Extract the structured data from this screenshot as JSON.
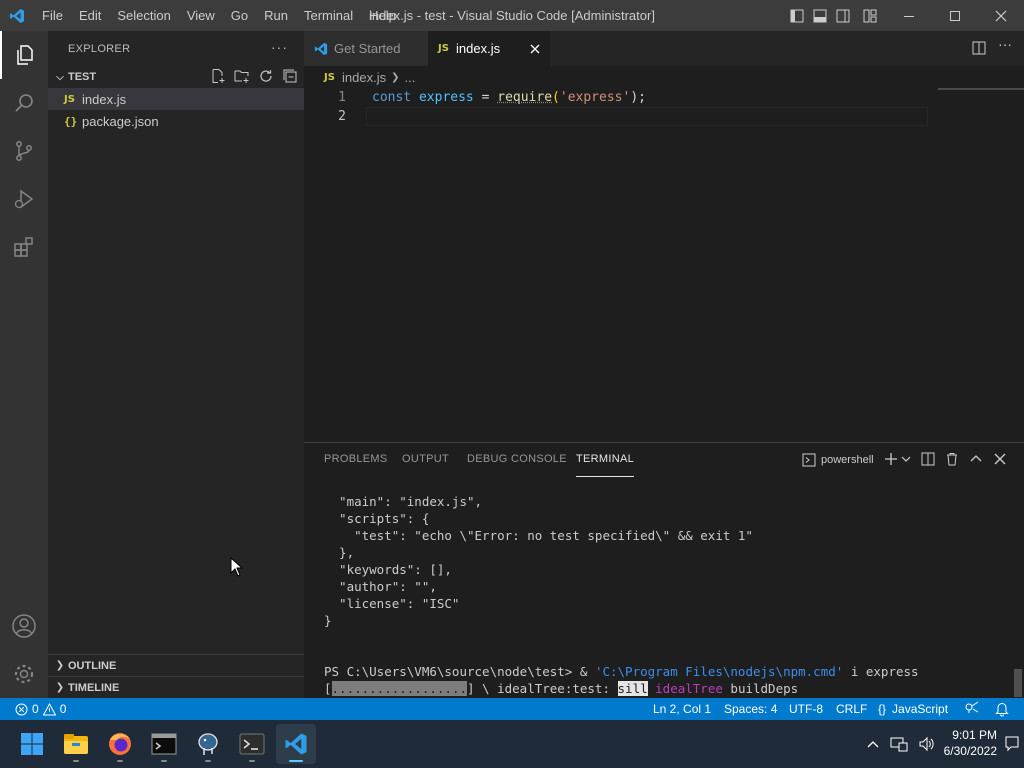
{
  "titlebar": {
    "menu": [
      "File",
      "Edit",
      "Selection",
      "View",
      "Go",
      "Run",
      "Terminal",
      "Help"
    ],
    "title": "index.js - test - Visual Studio Code [Administrator]"
  },
  "sidebar": {
    "header": "EXPLORER",
    "folder": "TEST",
    "files": [
      {
        "name": "index.js",
        "badge": "JS"
      },
      {
        "name": "package.json",
        "badge": "{}"
      }
    ],
    "outline": "OUTLINE",
    "timeline": "TIMELINE"
  },
  "tabs": [
    {
      "label": "Get Started",
      "active": false
    },
    {
      "label": "index.js",
      "badge": "JS",
      "active": true
    }
  ],
  "breadcrumb": {
    "file": "index.js",
    "badge": "JS",
    "rest": "..."
  },
  "editor": {
    "lines": [
      "1",
      "2"
    ],
    "code": {
      "kw": "const",
      "var": "express",
      "eq": "=",
      "fn": "require",
      "open": "(",
      "str": "'express'",
      "close": ");"
    }
  },
  "panel": {
    "tabs": [
      "PROBLEMS",
      "OUTPUT",
      "DEBUG CONSOLE",
      "TERMINAL"
    ],
    "shell": "powershell",
    "terminal": [
      "  \"main\": \"index.js\",",
      "  \"scripts\": {",
      "    \"test\": \"echo \\\"Error: no test specified\\\" && exit 1\"",
      "  },",
      "  \"keywords\": [],",
      "  \"author\": \"\",",
      "  \"license\": \"ISC\"",
      "}"
    ],
    "prompt": {
      "ps": "PS C:\\Users\\VM6\\source\\node\\test> & ",
      "path": "'C:\\Program Files\\nodejs\\npm.cmd'",
      "args": " i express"
    },
    "progress": {
      "open": "[",
      "bar": "..................",
      "close": "] \\ idealTree:test: ",
      "sill": "sill",
      "ideal": " idealTree",
      "build": " buildDeps"
    }
  },
  "statusbar": {
    "errors": "0",
    "warnings": "0",
    "position": "Ln 2, Col 1",
    "spaces": "Spaces: 4",
    "encoding": "UTF-8",
    "eol": "CRLF",
    "language": "JavaScript",
    "lang_icon": "{}"
  },
  "taskbar": {
    "time": "9:01 PM",
    "date": "6/30/2022"
  },
  "colors": {
    "accent": "#007acc",
    "keyword": "#569cd6",
    "variable": "#4fc1ff",
    "function": "#dcdcaa",
    "string": "#ce9178",
    "jsbadge": "#cbcb41"
  }
}
